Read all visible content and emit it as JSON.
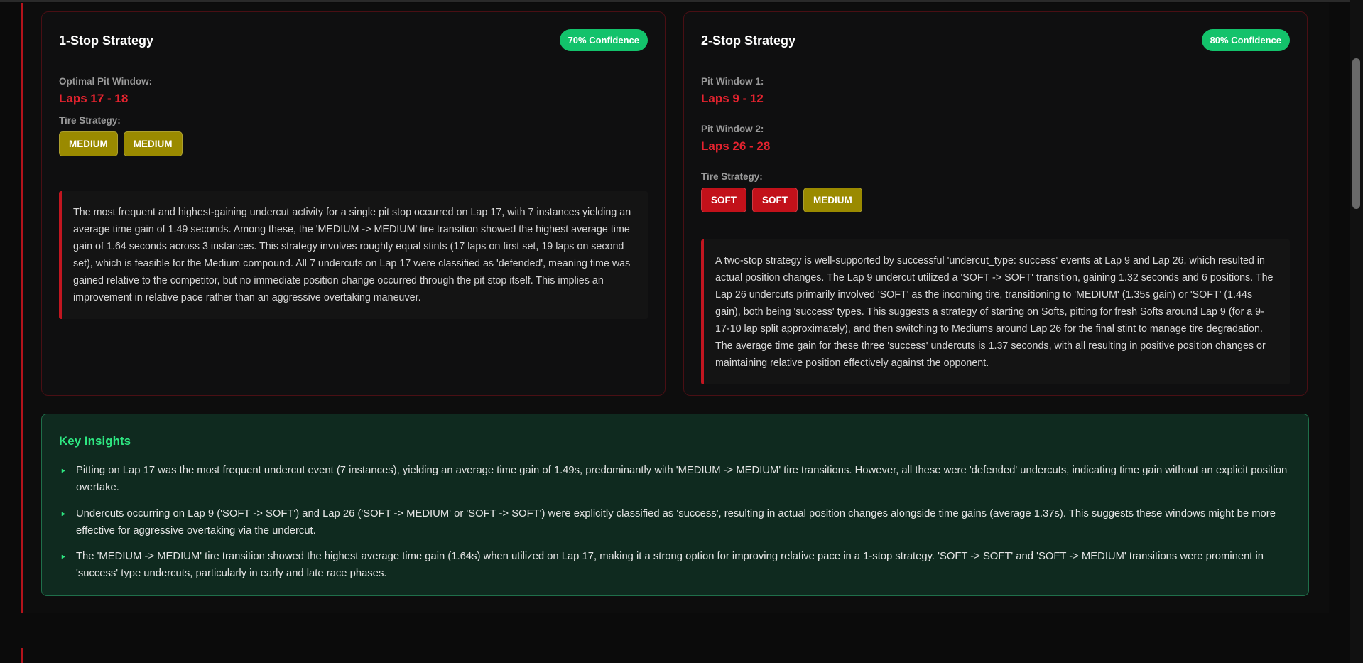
{
  "strategies": [
    {
      "title": "1-Stop Strategy",
      "confidence": "70% Confidence",
      "windows": [
        {
          "label": "Optimal Pit Window:",
          "value": "Laps 17 - 18"
        }
      ],
      "tire_label": "Tire Strategy:",
      "tires": [
        "MEDIUM",
        "MEDIUM"
      ],
      "note": "The most frequent and highest-gaining undercut activity for a single pit stop occurred on Lap 17, with 7 instances yielding an average time gain of 1.49 seconds. Among these, the 'MEDIUM -> MEDIUM' tire transition showed the highest average time gain of 1.64 seconds across 3 instances. This strategy involves roughly equal stints (17 laps on first set, 19 laps on second set), which is feasible for the Medium compound. All 7 undercuts on Lap 17 were classified as 'defended', meaning time was gained relative to the competitor, but no immediate position change occurred through the pit stop itself. This implies an improvement in relative pace rather than an aggressive overtaking maneuver."
    },
    {
      "title": "2-Stop Strategy",
      "confidence": "80% Confidence",
      "windows": [
        {
          "label": "Pit Window 1:",
          "value": "Laps 9 - 12"
        },
        {
          "label": "Pit Window 2:",
          "value": "Laps 26 - 28"
        }
      ],
      "tire_label": "Tire Strategy:",
      "tires": [
        "SOFT",
        "SOFT",
        "MEDIUM"
      ],
      "note": "A two-stop strategy is well-supported by successful 'undercut_type: success' events at Lap 9 and Lap 26, which resulted in actual position changes. The Lap 9 undercut utilized a 'SOFT -> SOFT' transition, gaining 1.32 seconds and 6 positions. The Lap 26 undercuts primarily involved 'SOFT' as the incoming tire, transitioning to 'MEDIUM' (1.35s gain) or 'SOFT' (1.44s gain), both being 'success' types. This suggests a strategy of starting on Softs, pitting for fresh Softs around Lap 9 (for a 9-17-10 lap split approximately), and then switching to Mediums around Lap 26 for the final stint to manage tire degradation. The average time gain for these three 'success' undercuts is 1.37 seconds, with all resulting in positive position changes or maintaining relative position effectively against the opponent."
    }
  ],
  "insights": {
    "title": "Key Insights",
    "items": [
      "Pitting on Lap 17 was the most frequent undercut event (7 instances), yielding an average time gain of 1.49s, predominantly with 'MEDIUM -> MEDIUM' tire transitions. However, all these were 'defended' undercuts, indicating time gain without an explicit position overtake.",
      "Undercuts occurring on Lap 9 ('SOFT -> SOFT') and Lap 26 ('SOFT -> MEDIUM' or 'SOFT -> SOFT') were explicitly classified as 'success', resulting in actual position changes alongside time gains (average 1.37s). This suggests these windows might be more effective for aggressive overtaking via the undercut.",
      "The 'MEDIUM -> MEDIUM' tire transition showed the highest average time gain (1.64s) when utilized on Lap 17, making it a strong option for improving relative pace in a 1-stop strategy. 'SOFT -> SOFT' and 'SOFT -> MEDIUM' transitions were prominent in 'success' type undercuts, particularly in early and late race phases."
    ]
  },
  "colors": {
    "accent_red": "#e5232f",
    "confidence_green": "#13c26b",
    "tire_medium": "#9a8a00",
    "tire_soft": "#c2111a",
    "insight_green": "#2ee882"
  }
}
